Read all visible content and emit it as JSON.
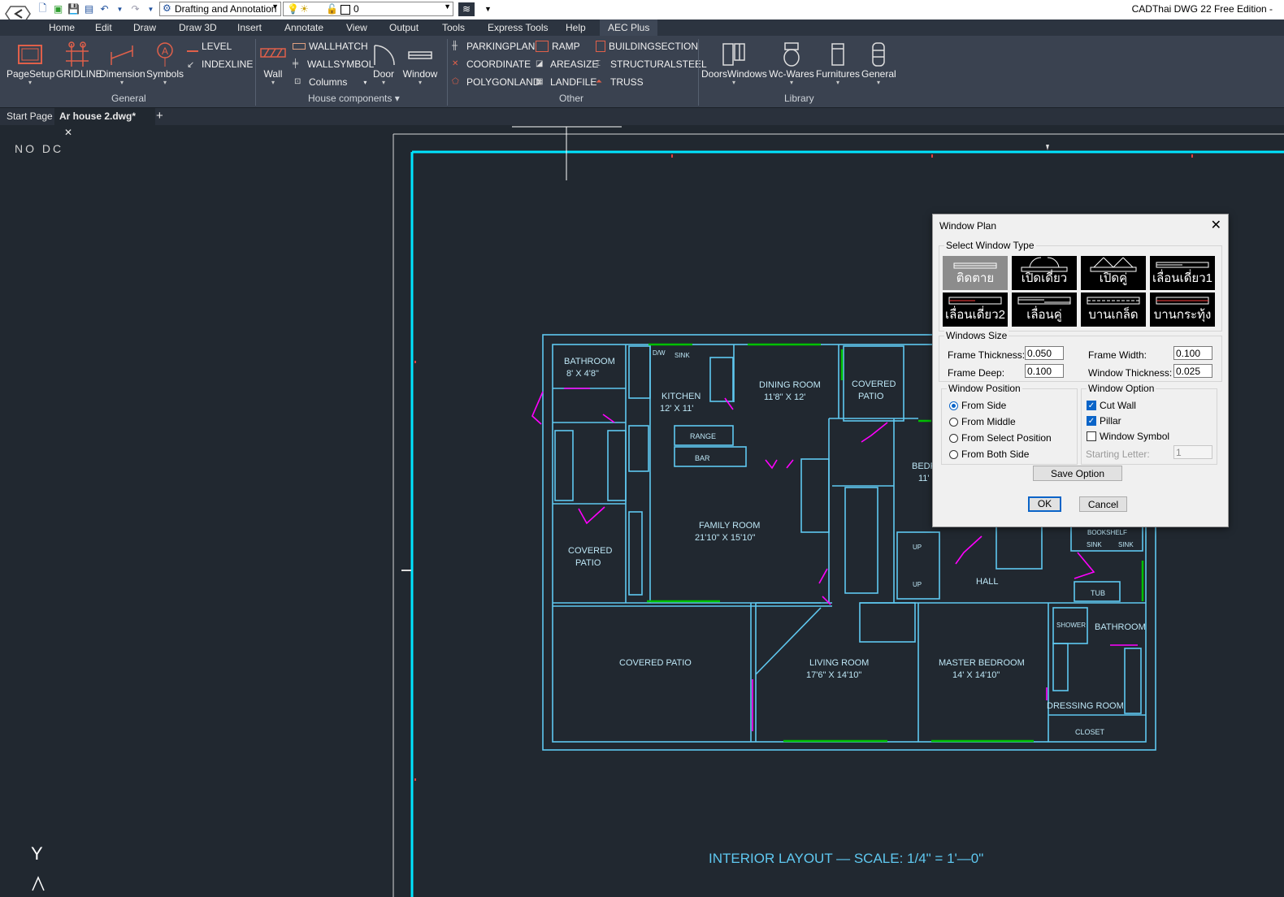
{
  "titlebar": {
    "app_title": "CADThai DWG 22 Free Edition  -",
    "workspace": "Drafting and Annotation",
    "layer": "0"
  },
  "menus": [
    "Home",
    "Edit",
    "Draw",
    "Draw 3D",
    "Insert",
    "Annotate",
    "View",
    "Output",
    "Tools",
    "Express Tools",
    "Help",
    "AEC Plus"
  ],
  "ribbon": {
    "general": {
      "label": "General",
      "page_setup": "PageSetup",
      "gridline": "GRIDLINE",
      "dimension": "Dimension",
      "symbols": "Symbols",
      "level": "LEVEL",
      "indexline": "INDEXLINE"
    },
    "house": {
      "label": "House components",
      "wall": "Wall",
      "wallhatch": "WALLHATCH",
      "wallsymbol": "WALLSYMBOL",
      "columns": "Columns",
      "door": "Door",
      "window": "Window"
    },
    "other": {
      "label": "Other",
      "parkingplan": "PARKINGPLAN",
      "coordinate": "COORDINATE",
      "polygonland": "POLYGONLAND",
      "ramp": "RAMP",
      "areasize": "AREASIZE",
      "landfile": "LANDFILE",
      "buildingsection": "BUILDINGSECTION",
      "structuralsteel": "STRUCTURALSTEEL",
      "truss": "TRUSS"
    },
    "library": {
      "label": "Library",
      "doorswindows": "DoorsWindows",
      "wcwares": "Wc-Wares",
      "furnitures": "Furnitures",
      "general": "General"
    }
  },
  "tabs": {
    "start": "Start Page",
    "doc": "Ar house 2.dwg*",
    "close": "✕",
    "add": "+"
  },
  "canvas": {
    "no_dc": "NO DC",
    "caption": "INTERIOR  LAYOUT  —    SCALE:  1/4\"  =  1'—0\"",
    "ucs_y": "Y",
    "rooms": {
      "bathroom": "BATHROOM",
      "bathroom_size": "8'  X  4'8\"",
      "kitchen": "KITCHEN",
      "kitchen_size": "12'  X  11'",
      "dining": "DINING  ROOM",
      "dining_size": "11'8\"  X  12'",
      "covered_patio_top": "COVERED",
      "covered_patio_top2": "PATIO",
      "range": "RANGE",
      "bar": "BAR",
      "family": "FAMILY  ROOM",
      "family_size": "21'10\"  X  15'10\"",
      "covered_patio_left": "COVERED",
      "covered_patio_left2": "PATIO",
      "covered_patio_bottom": "COVERED  PATIO",
      "living": "LIVING  ROOM",
      "living_size": "17'6\"  X  14'10\"",
      "master": "MASTER  BEDROOM",
      "master_size": "14'  X  14'10\"",
      "bathroom2": "BATHROOM",
      "dressing": "DRESSING  ROOM",
      "closet": "CLOSET",
      "hall": "HALL",
      "tub": "TUB",
      "shower": "SHOWER",
      "bookshelf": "BOOKSHELF",
      "sink": "SINK",
      "sink2": "SINK",
      "dw": "D/W",
      "sink3": "SINK",
      "bedroom_partial": "BEDR",
      "bedroom_partial2": "11'",
      "up": "UP",
      "up2": "UP"
    }
  },
  "dialog": {
    "title": "Window Plan",
    "close": "✕",
    "select_type": "Select Window Type",
    "types": [
      "ติดตาย",
      "เปิดเดี่ยว",
      "เปิดคู่",
      "เลื่อนเดี่ยว1",
      "เลื่อนเดี่ยว2",
      "เลื่อนคู่",
      "บานเกล็ด",
      "บานกระทุ้ง"
    ],
    "windows_size": "Windows Size",
    "frame_thickness_label": "Frame Thickness:",
    "frame_thickness": "0.050",
    "frame_width_label": "Frame Width:",
    "frame_width": "0.100",
    "frame_deep_label": "Frame Deep:",
    "frame_deep": "0.100",
    "window_thickness_label": "Window Thickness:",
    "window_thickness": "0.025",
    "position_label": "Window Position",
    "positions": [
      "From Side",
      "From Middle",
      "From Select Position",
      "From Both Side"
    ],
    "option_label": "Window Option",
    "cut_wall": "Cut Wall",
    "pillar": "Pillar",
    "window_symbol": "Window Symbol",
    "starting_letter_label": "Starting Letter:",
    "starting_letter": "1",
    "save_option": "Save Option",
    "ok": "OK",
    "cancel": "Cancel"
  },
  "colors": {
    "background": "#212830",
    "plan_lines": "#5fc8f0",
    "border_cyan": "#00e5ff",
    "door_magenta": "#ff00ff",
    "window_green": "#00c000"
  }
}
